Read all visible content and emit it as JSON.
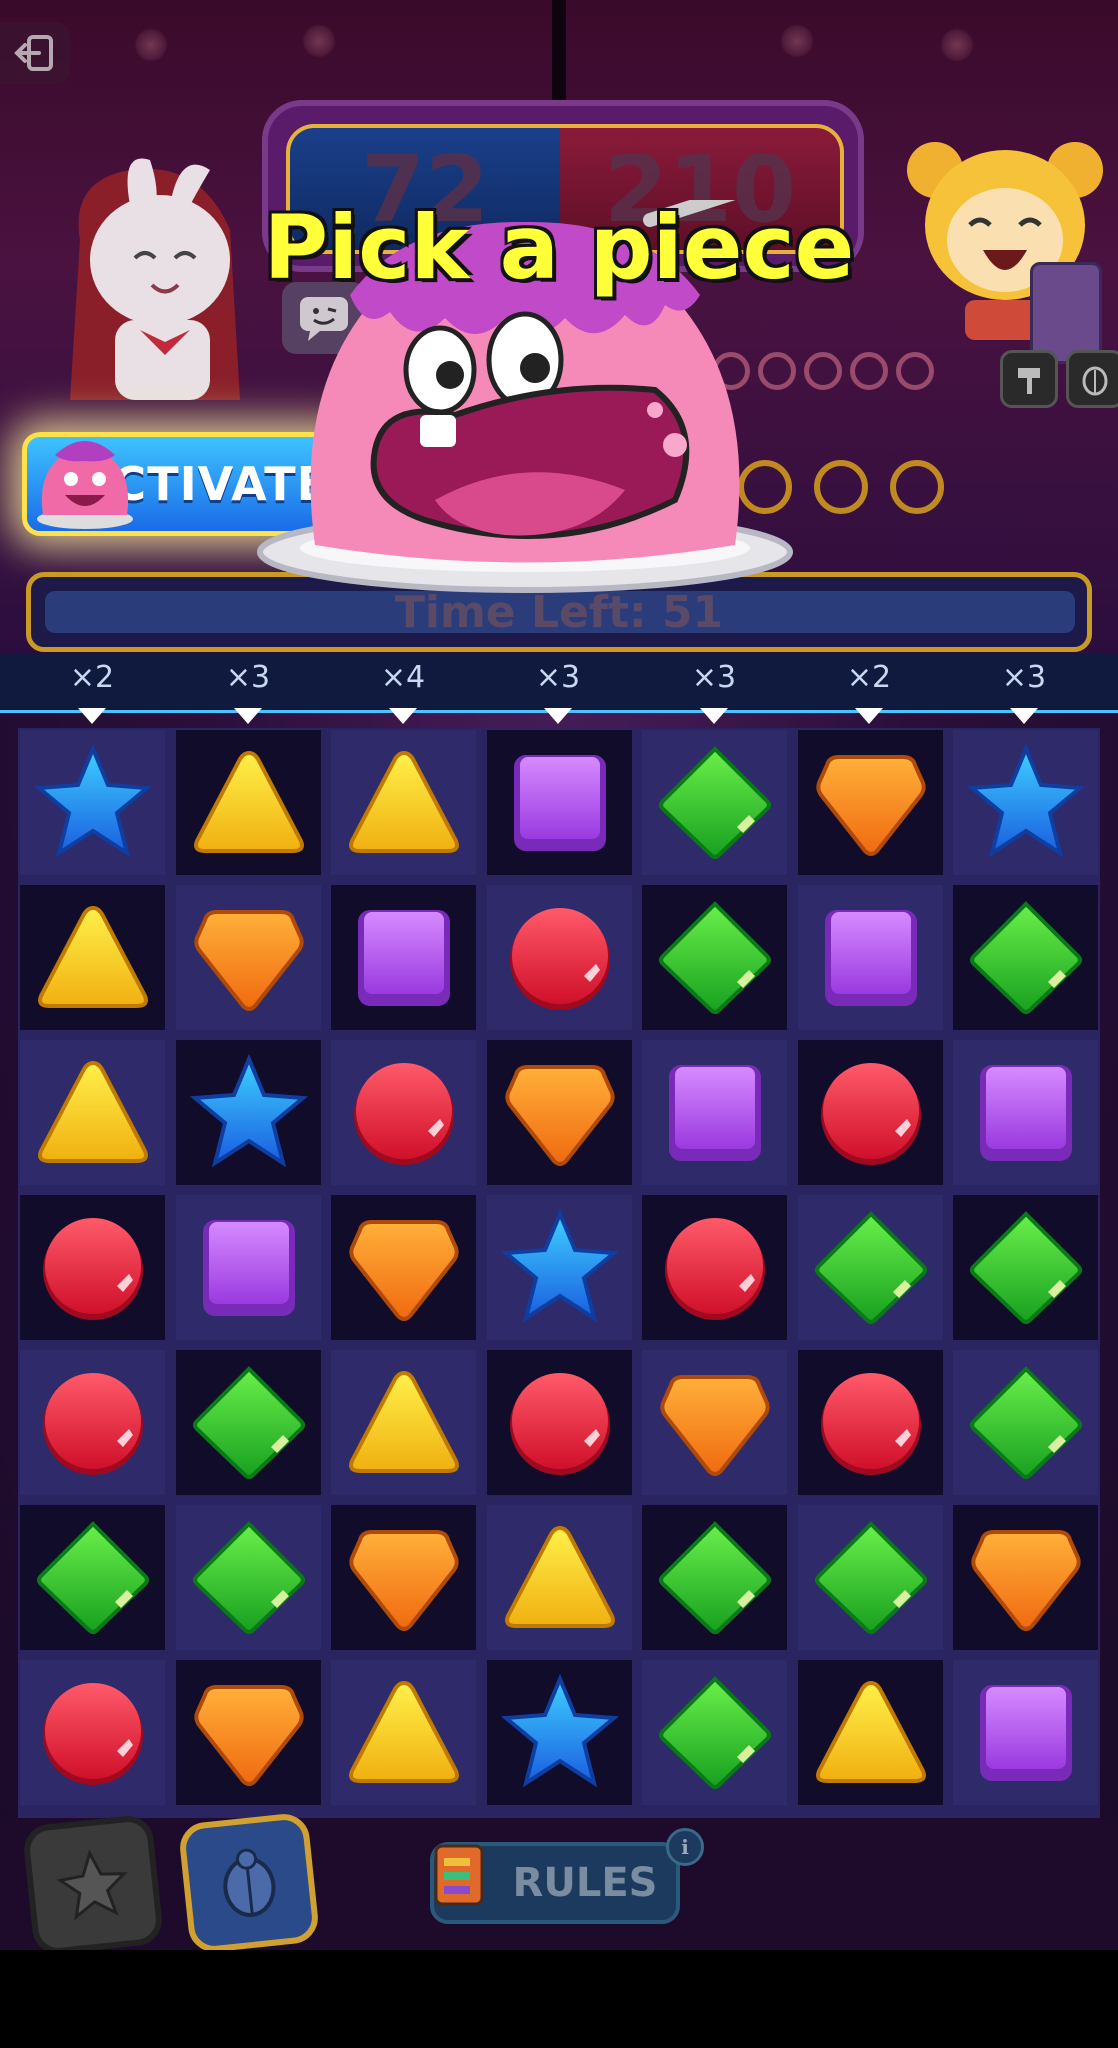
{
  "title": "Pick a piece",
  "scores": {
    "left": "72",
    "right": "210"
  },
  "activate_label": "ACTIVATE",
  "timer_text": "Time Left: 51",
  "multipliers": [
    "×2",
    "×3",
    "×4",
    "×3",
    "×3",
    "×2",
    "×3"
  ],
  "rules_label": "RULES",
  "info_label": "i",
  "icons": {
    "exit": "exit-icon",
    "chat": "chat-icon",
    "hammer": "hammer-icon",
    "beetle": "beetle-icon",
    "star_tool": "star-tool-icon",
    "rules": "book-icon"
  },
  "colors": {
    "title": "#ffff3a",
    "activate_bg": "#2a8df5",
    "timer_border": "#c99a24",
    "board_bg": "#2a2460"
  },
  "board": [
    [
      "blue-star",
      "yellow-triangle",
      "yellow-triangle",
      "purple-square",
      "green-diamond",
      "orange-shield",
      "blue-star"
    ],
    [
      "yellow-triangle",
      "orange-shield",
      "purple-square",
      "red-circle",
      "green-diamond",
      "purple-square",
      "green-diamond"
    ],
    [
      "yellow-triangle",
      "blue-star",
      "red-circle",
      "orange-shield",
      "purple-square",
      "red-circle",
      "purple-square"
    ],
    [
      "red-circle",
      "purple-square",
      "orange-shield",
      "blue-star",
      "red-circle",
      "green-diamond",
      "green-diamond"
    ],
    [
      "red-circle",
      "green-diamond",
      "yellow-triangle",
      "red-circle",
      "orange-shield",
      "red-circle",
      "green-diamond"
    ],
    [
      "green-diamond",
      "green-diamond",
      "orange-shield",
      "yellow-triangle",
      "green-diamond",
      "green-diamond",
      "orange-shield"
    ],
    [
      "red-circle",
      "orange-shield",
      "yellow-triangle",
      "blue-star",
      "green-diamond",
      "yellow-triangle",
      "purple-square"
    ]
  ]
}
